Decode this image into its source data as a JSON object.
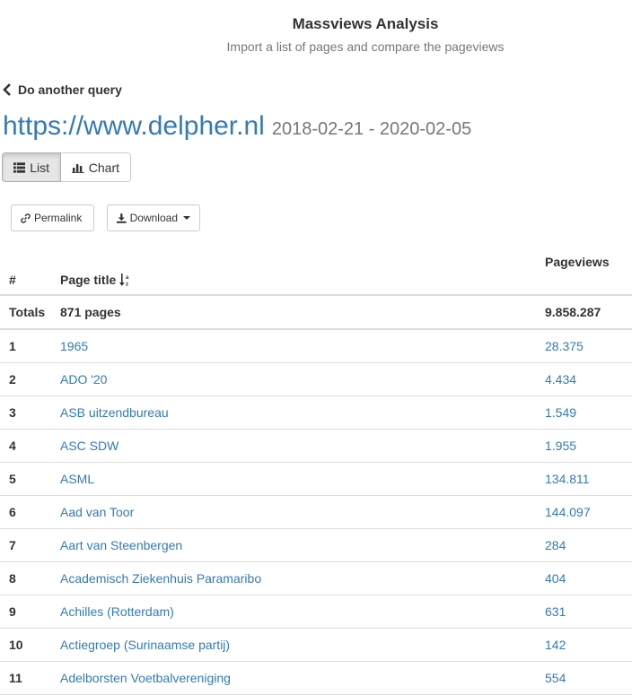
{
  "header": {
    "title": "Massviews Analysis",
    "subtitle": "Import a list of pages and compare the pageviews"
  },
  "back_link": "Do another query",
  "site": {
    "url": "https://www.delpher.nl",
    "date_range": "2018-02-21 - 2020-02-05"
  },
  "view_toggle": {
    "list_label": "List",
    "chart_label": "Chart",
    "active": "List"
  },
  "tools": {
    "permalink_label": "Permalink",
    "download_label": "Download"
  },
  "table": {
    "headers": {
      "num": "#",
      "title": "Page title",
      "pageviews": "Pageviews"
    },
    "totals": {
      "label": "Totals",
      "pages": "871 pages",
      "pageviews": "9.858.287"
    },
    "rows": [
      {
        "num": "1",
        "title": "1965",
        "pageviews": "28.375"
      },
      {
        "num": "2",
        "title": "ADO '20",
        "pageviews": "4.434"
      },
      {
        "num": "3",
        "title": "ASB uitzendbureau",
        "pageviews": "1.549"
      },
      {
        "num": "4",
        "title": "ASC SDW",
        "pageviews": "1.955"
      },
      {
        "num": "5",
        "title": "ASML",
        "pageviews": "134.811"
      },
      {
        "num": "6",
        "title": "Aad van Toor",
        "pageviews": "144.097"
      },
      {
        "num": "7",
        "title": "Aart van Steenbergen",
        "pageviews": "284"
      },
      {
        "num": "8",
        "title": "Academisch Ziekenhuis Paramaribo",
        "pageviews": "404"
      },
      {
        "num": "9",
        "title": "Achilles (Rotterdam)",
        "pageviews": "631"
      },
      {
        "num": "10",
        "title": "Actiegroep (Surinaamse partij)",
        "pageviews": "142"
      },
      {
        "num": "11",
        "title": "Adelborsten Voetbalvereniging",
        "pageviews": "554"
      }
    ]
  },
  "colors": {
    "link": "#337ab7",
    "muted": "#777777",
    "border": "#dddddd"
  }
}
